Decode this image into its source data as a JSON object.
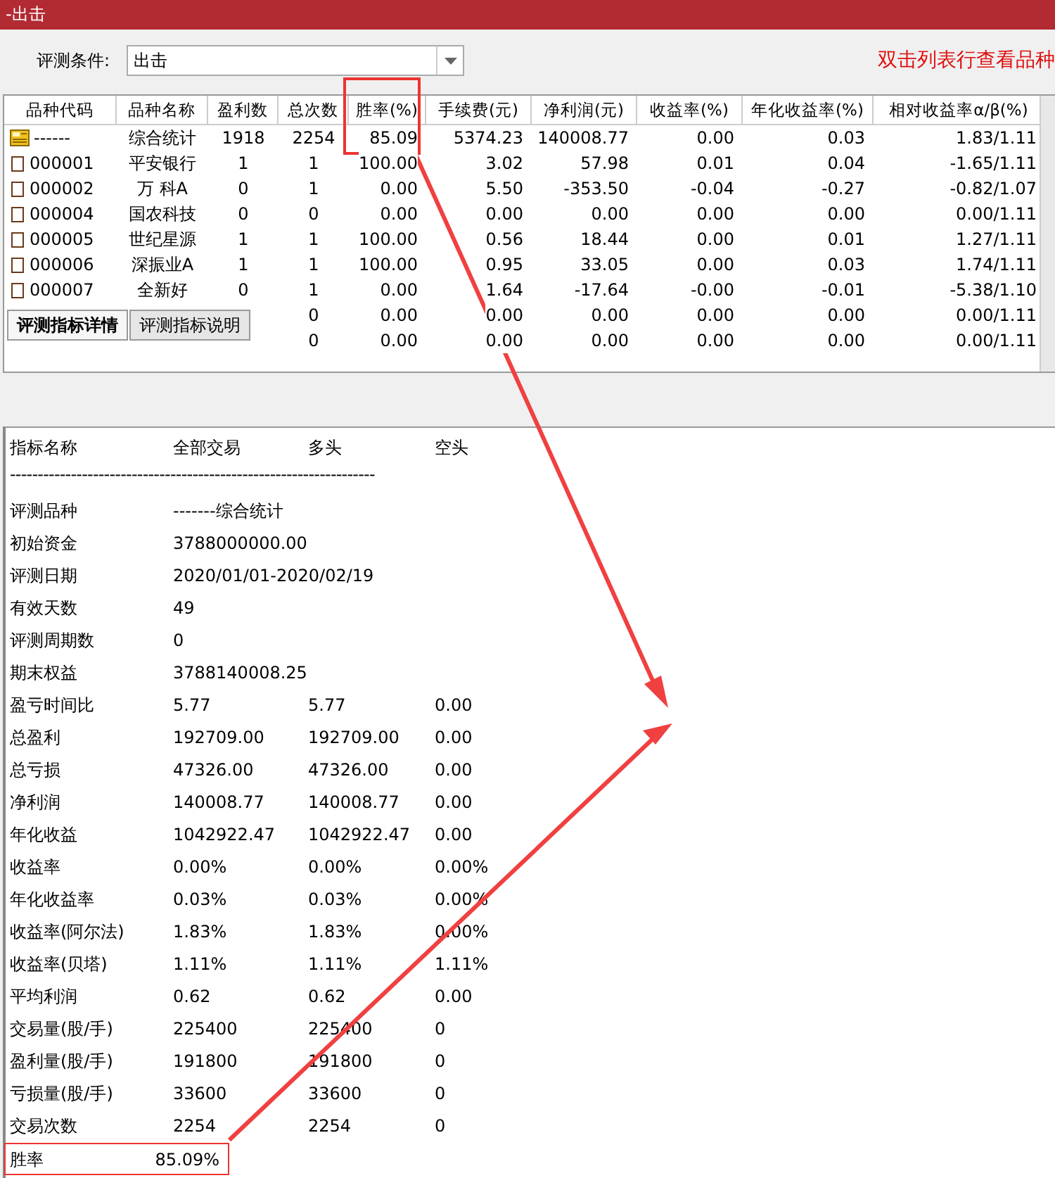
{
  "window": {
    "title": "-出击"
  },
  "condition": {
    "label": "评测条件:",
    "value": "出击"
  },
  "hint": "双击列表行查看品种",
  "table": {
    "columns": [
      "品种代码",
      "品种名称",
      "盈利数",
      "总次数",
      "胜率(%)",
      "手续费(元)",
      "净利润(元)",
      "收益率(%)",
      "年化收益率(%)",
      "相对收益率α/β(%)"
    ],
    "rows": [
      {
        "kind": "summary",
        "cells": [
          "------",
          "综合统计",
          "1918",
          "2254",
          "85.09",
          "5374.23",
          "140008.77",
          "0.00",
          "0.03",
          "1.83/1.11"
        ]
      },
      {
        "kind": "stock",
        "cells": [
          "000001",
          "平安银行",
          "1",
          "1",
          "100.00",
          "3.02",
          "57.98",
          "0.01",
          "0.04",
          "-1.65/1.11"
        ]
      },
      {
        "kind": "stock",
        "cells": [
          "000002",
          "万 科A",
          "0",
          "1",
          "0.00",
          "5.50",
          "-353.50",
          "-0.04",
          "-0.27",
          "-0.82/1.07"
        ]
      },
      {
        "kind": "stock",
        "cells": [
          "000004",
          "国农科技",
          "0",
          "0",
          "0.00",
          "0.00",
          "0.00",
          "0.00",
          "0.00",
          "0.00/1.11"
        ]
      },
      {
        "kind": "stock",
        "cells": [
          "000005",
          "世纪星源",
          "1",
          "1",
          "100.00",
          "0.56",
          "18.44",
          "0.00",
          "0.01",
          "1.27/1.11"
        ]
      },
      {
        "kind": "stock",
        "cells": [
          "000006",
          "深振业A",
          "1",
          "1",
          "100.00",
          "0.95",
          "33.05",
          "0.00",
          "0.03",
          "1.74/1.11"
        ]
      },
      {
        "kind": "stock",
        "cells": [
          "000007",
          "全新好",
          "0",
          "1",
          "0.00",
          "1.64",
          "-17.64",
          "-0.00",
          "-0.01",
          "-5.38/1.10"
        ]
      },
      {
        "kind": "hidden",
        "cells": [
          "",
          "",
          "",
          "0",
          "0.00",
          "0.00",
          "0.00",
          "0.00",
          "0.00",
          "0.00/1.11"
        ]
      },
      {
        "kind": "hidden",
        "cells": [
          "",
          "",
          "",
          "0",
          "0.00",
          "0.00",
          "0.00",
          "0.00",
          "0.00",
          "0.00/1.11"
        ]
      }
    ]
  },
  "tabs": [
    {
      "label": "评测指标详情",
      "selected": true
    },
    {
      "label": "评测指标说明",
      "selected": false
    }
  ],
  "detail": {
    "header": [
      "指标名称",
      "全部交易",
      "多头",
      "空头"
    ],
    "separator": "------------------------------------------------------------------",
    "rows": [
      [
        "评测品种",
        "-------综合统计"
      ],
      [
        "初始资金",
        "3788000000.00"
      ],
      [
        "评测日期",
        "2020/01/01-2020/02/19"
      ],
      [
        "有效天数",
        "49"
      ],
      [
        "评测周期数",
        "0"
      ],
      [
        "期末权益",
        "3788140008.25"
      ],
      [
        "盈亏时间比",
        "5.77",
        "5.77",
        "0.00"
      ],
      [
        "总盈利",
        "192709.00",
        "192709.00",
        "0.00"
      ],
      [
        "总亏损",
        "47326.00",
        "47326.00",
        "0.00"
      ],
      [
        "净利润",
        "140008.77",
        "140008.77",
        "0.00"
      ],
      [
        "年化收益",
        "1042922.47",
        "1042922.47",
        "0.00"
      ],
      [
        "收益率",
        "0.00%",
        "0.00%",
        "0.00%"
      ],
      [
        "年化收益率",
        "0.03%",
        "0.03%",
        "0.00%"
      ],
      [
        "收益率(阿尔法)",
        "1.83%",
        "1.83%",
        "0.00%"
      ],
      [
        "收益率(贝塔)",
        "1.11%",
        "1.11%",
        "1.11%"
      ],
      [
        "平均利润",
        "0.62",
        "0.62",
        "0.00"
      ],
      [
        "交易量(股/手)",
        "225400",
        "225400",
        "0"
      ],
      [
        "盈利量(股/手)",
        "191800",
        "191800",
        "0"
      ],
      [
        "亏损量(股/手)",
        "33600",
        "33600",
        "0"
      ],
      [
        "交易次数",
        "2254",
        "2254",
        "0"
      ],
      [
        "胜率",
        "85.09%"
      ]
    ]
  }
}
